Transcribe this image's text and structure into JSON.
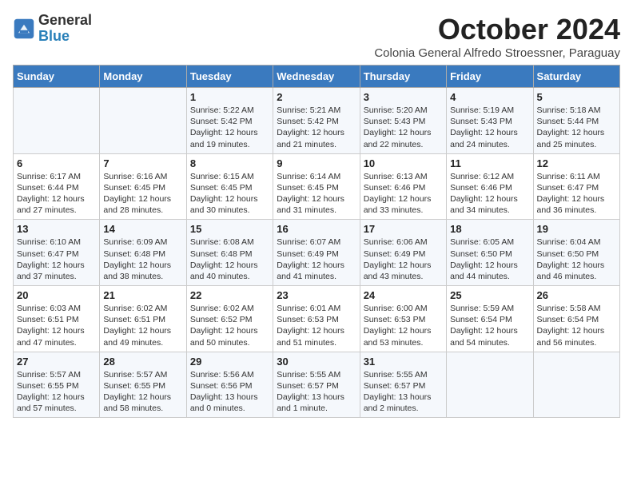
{
  "logo": {
    "general": "General",
    "blue": "Blue"
  },
  "title": "October 2024",
  "subtitle": "Colonia General Alfredo Stroessner, Paraguay",
  "days_of_week": [
    "Sunday",
    "Monday",
    "Tuesday",
    "Wednesday",
    "Thursday",
    "Friday",
    "Saturday"
  ],
  "weeks": [
    [
      {
        "day": "",
        "info": ""
      },
      {
        "day": "",
        "info": ""
      },
      {
        "day": "1",
        "info": "Sunrise: 5:22 AM\nSunset: 5:42 PM\nDaylight: 12 hours and 19 minutes."
      },
      {
        "day": "2",
        "info": "Sunrise: 5:21 AM\nSunset: 5:42 PM\nDaylight: 12 hours and 21 minutes."
      },
      {
        "day": "3",
        "info": "Sunrise: 5:20 AM\nSunset: 5:43 PM\nDaylight: 12 hours and 22 minutes."
      },
      {
        "day": "4",
        "info": "Sunrise: 5:19 AM\nSunset: 5:43 PM\nDaylight: 12 hours and 24 minutes."
      },
      {
        "day": "5",
        "info": "Sunrise: 5:18 AM\nSunset: 5:44 PM\nDaylight: 12 hours and 25 minutes."
      }
    ],
    [
      {
        "day": "6",
        "info": "Sunrise: 6:17 AM\nSunset: 6:44 PM\nDaylight: 12 hours and 27 minutes."
      },
      {
        "day": "7",
        "info": "Sunrise: 6:16 AM\nSunset: 6:45 PM\nDaylight: 12 hours and 28 minutes."
      },
      {
        "day": "8",
        "info": "Sunrise: 6:15 AM\nSunset: 6:45 PM\nDaylight: 12 hours and 30 minutes."
      },
      {
        "day": "9",
        "info": "Sunrise: 6:14 AM\nSunset: 6:45 PM\nDaylight: 12 hours and 31 minutes."
      },
      {
        "day": "10",
        "info": "Sunrise: 6:13 AM\nSunset: 6:46 PM\nDaylight: 12 hours and 33 minutes."
      },
      {
        "day": "11",
        "info": "Sunrise: 6:12 AM\nSunset: 6:46 PM\nDaylight: 12 hours and 34 minutes."
      },
      {
        "day": "12",
        "info": "Sunrise: 6:11 AM\nSunset: 6:47 PM\nDaylight: 12 hours and 36 minutes."
      }
    ],
    [
      {
        "day": "13",
        "info": "Sunrise: 6:10 AM\nSunset: 6:47 PM\nDaylight: 12 hours and 37 minutes."
      },
      {
        "day": "14",
        "info": "Sunrise: 6:09 AM\nSunset: 6:48 PM\nDaylight: 12 hours and 38 minutes."
      },
      {
        "day": "15",
        "info": "Sunrise: 6:08 AM\nSunset: 6:48 PM\nDaylight: 12 hours and 40 minutes."
      },
      {
        "day": "16",
        "info": "Sunrise: 6:07 AM\nSunset: 6:49 PM\nDaylight: 12 hours and 41 minutes."
      },
      {
        "day": "17",
        "info": "Sunrise: 6:06 AM\nSunset: 6:49 PM\nDaylight: 12 hours and 43 minutes."
      },
      {
        "day": "18",
        "info": "Sunrise: 6:05 AM\nSunset: 6:50 PM\nDaylight: 12 hours and 44 minutes."
      },
      {
        "day": "19",
        "info": "Sunrise: 6:04 AM\nSunset: 6:50 PM\nDaylight: 12 hours and 46 minutes."
      }
    ],
    [
      {
        "day": "20",
        "info": "Sunrise: 6:03 AM\nSunset: 6:51 PM\nDaylight: 12 hours and 47 minutes."
      },
      {
        "day": "21",
        "info": "Sunrise: 6:02 AM\nSunset: 6:51 PM\nDaylight: 12 hours and 49 minutes."
      },
      {
        "day": "22",
        "info": "Sunrise: 6:02 AM\nSunset: 6:52 PM\nDaylight: 12 hours and 50 minutes."
      },
      {
        "day": "23",
        "info": "Sunrise: 6:01 AM\nSunset: 6:53 PM\nDaylight: 12 hours and 51 minutes."
      },
      {
        "day": "24",
        "info": "Sunrise: 6:00 AM\nSunset: 6:53 PM\nDaylight: 12 hours and 53 minutes."
      },
      {
        "day": "25",
        "info": "Sunrise: 5:59 AM\nSunset: 6:54 PM\nDaylight: 12 hours and 54 minutes."
      },
      {
        "day": "26",
        "info": "Sunrise: 5:58 AM\nSunset: 6:54 PM\nDaylight: 12 hours and 56 minutes."
      }
    ],
    [
      {
        "day": "27",
        "info": "Sunrise: 5:57 AM\nSunset: 6:55 PM\nDaylight: 12 hours and 57 minutes."
      },
      {
        "day": "28",
        "info": "Sunrise: 5:57 AM\nSunset: 6:55 PM\nDaylight: 12 hours and 58 minutes."
      },
      {
        "day": "29",
        "info": "Sunrise: 5:56 AM\nSunset: 6:56 PM\nDaylight: 13 hours and 0 minutes."
      },
      {
        "day": "30",
        "info": "Sunrise: 5:55 AM\nSunset: 6:57 PM\nDaylight: 13 hours and 1 minute."
      },
      {
        "day": "31",
        "info": "Sunrise: 5:55 AM\nSunset: 6:57 PM\nDaylight: 13 hours and 2 minutes."
      },
      {
        "day": "",
        "info": ""
      },
      {
        "day": "",
        "info": ""
      }
    ]
  ]
}
